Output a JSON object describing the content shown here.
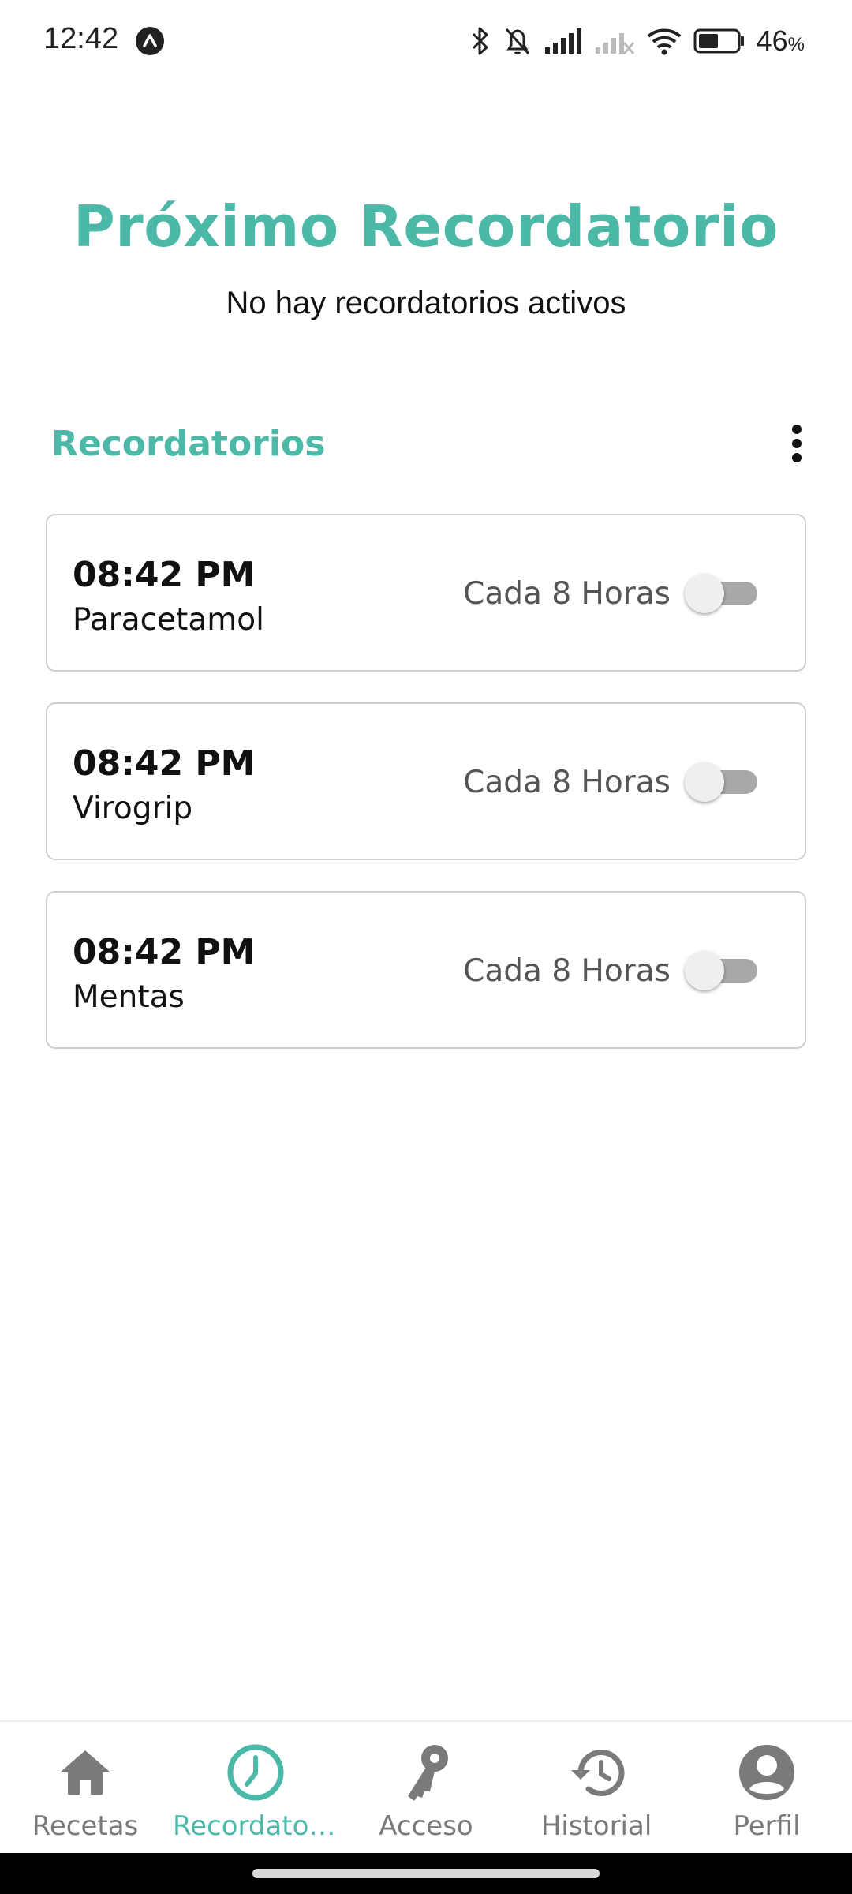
{
  "status_bar": {
    "time": "12:42",
    "battery_percent": "46",
    "battery_unit": "%",
    "icons": [
      "app-icon",
      "bluetooth-icon",
      "bell-off-icon",
      "signal-icon",
      "signal-off-icon",
      "wifi-icon",
      "battery-icon"
    ]
  },
  "header": {
    "title": "Próximo Recordatorio",
    "subtitle": "No hay recordatorios activos"
  },
  "section": {
    "title": "Recordatorios",
    "menu_icon": "more-vert-icon"
  },
  "reminders": [
    {
      "time": "08:42 PM",
      "name": "Paracetamol",
      "frequency": "Cada 8 Horas",
      "enabled": false
    },
    {
      "time": "08:42 PM",
      "name": "Virogrip",
      "frequency": "Cada 8 Horas",
      "enabled": false
    },
    {
      "time": "08:42 PM",
      "name": "Mentas",
      "frequency": "Cada 8 Horas",
      "enabled": false
    }
  ],
  "nav": {
    "items": [
      {
        "label": "Recetas",
        "icon": "home-icon",
        "active": false
      },
      {
        "label": "Recordator...",
        "icon": "clock-icon",
        "active": true
      },
      {
        "label": "Acceso",
        "icon": "key-icon",
        "active": false
      },
      {
        "label": "Historial",
        "icon": "history-icon",
        "active": false
      },
      {
        "label": "Perfil",
        "icon": "account-icon",
        "active": false
      }
    ]
  },
  "colors": {
    "accent": "#4cb8a8",
    "inactive": "#7a7a7a",
    "card_border": "#cfcfcf"
  }
}
